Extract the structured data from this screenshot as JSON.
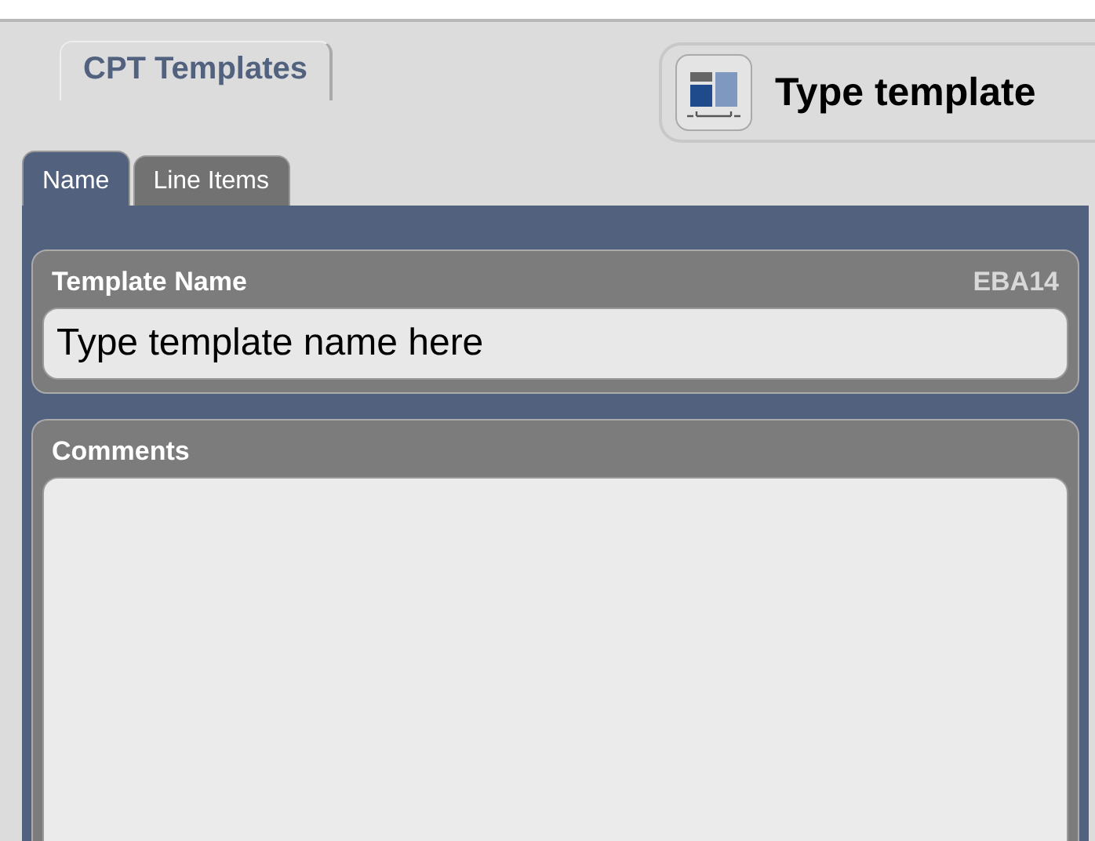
{
  "header": {
    "section_tab": {
      "label": "CPT Templates"
    },
    "title": "Type template"
  },
  "tabs": [
    {
      "label": "Name",
      "selected": true
    },
    {
      "label": "Line Items",
      "selected": false
    }
  ],
  "template_name": {
    "label": "Template Name",
    "code": "EBA14",
    "value": "Type template name here"
  },
  "comments": {
    "label": "Comments"
  }
}
